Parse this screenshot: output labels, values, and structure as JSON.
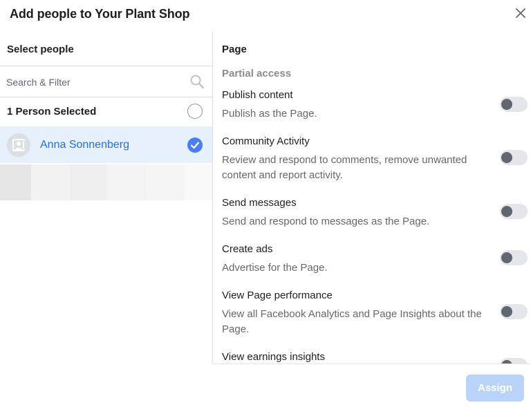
{
  "dialog": {
    "title": "Add people to Your Plant Shop"
  },
  "left_pane": {
    "header": "Select people",
    "search": {
      "placeholder": "Search & Filter",
      "value": ""
    },
    "selected_count_label": "1 Person Selected",
    "people": [
      {
        "name": "Anna Sonnenberg",
        "selected": true
      }
    ]
  },
  "right_pane": {
    "header": "Page",
    "section": "Partial access",
    "permissions": [
      {
        "title": "Publish content",
        "description": "Publish as the Page.",
        "enabled": false
      },
      {
        "title": "Community Activity",
        "description": "Review and respond to comments, remove unwanted content and report activity.",
        "enabled": false
      },
      {
        "title": "Send messages",
        "description": "Send and respond to messages as the Page.",
        "enabled": false
      },
      {
        "title": "Create ads",
        "description": "Advertise for the Page.",
        "enabled": false
      },
      {
        "title": "View Page performance",
        "description": "View all Facebook Analytics and Page Insights about the Page.",
        "enabled": false
      },
      {
        "title": "View earnings insights",
        "description": "",
        "enabled": false
      }
    ]
  },
  "footer": {
    "assign_label": "Assign"
  },
  "colors": {
    "accent_blue": "#4a7ef2",
    "selected_row_bg": "#e7f0fd",
    "name_link": "#216fdb",
    "assign_disabled": "#bad3f8",
    "toggle_track": "#e4e6eb",
    "toggle_knob": "#606770"
  },
  "icons": {
    "close": "close-icon",
    "search": "search-icon",
    "avatar": "person-avatar-icon",
    "check": "checkmark-icon"
  }
}
